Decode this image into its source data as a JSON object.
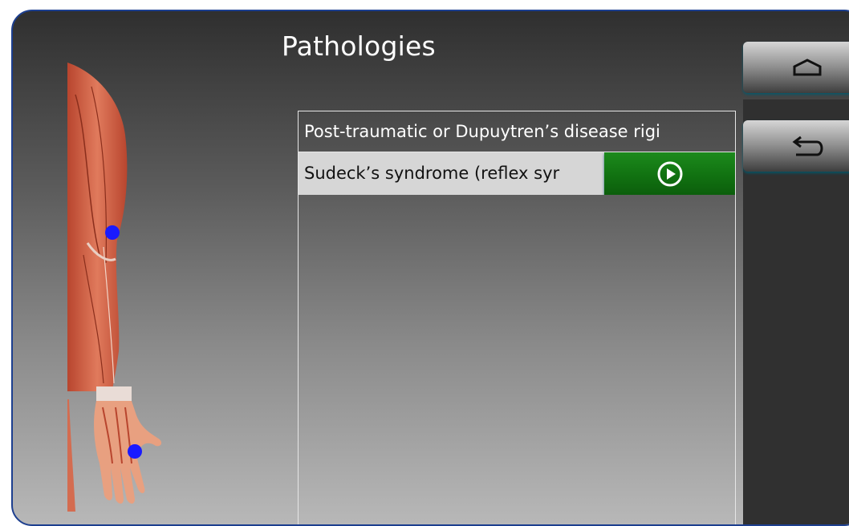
{
  "header": {
    "title": "Pathologies"
  },
  "pathologies": {
    "items": [
      {
        "label": "Post-traumatic or Dupuytren’s disease rigi"
      },
      {
        "label": "Sudeck’s syndrome (reflex syr"
      }
    ],
    "selected_index": 1
  },
  "icons": {
    "play": "play-circle-icon",
    "home": "home-icon",
    "back": "back-arrow-icon"
  },
  "colors": {
    "accent_green": "#117211",
    "marker_blue": "#1a1aff",
    "frame_border": "#1d3f8f"
  }
}
